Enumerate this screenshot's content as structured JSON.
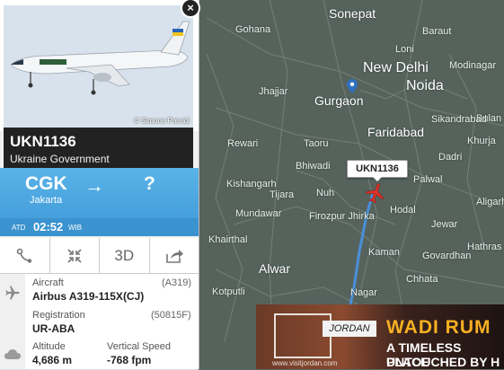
{
  "map": {
    "cities": [
      {
        "name": "Sonepat",
        "size": "m"
      },
      {
        "name": "New Delhi",
        "size": "l"
      },
      {
        "name": "Noida",
        "size": "l"
      },
      {
        "name": "Gurgaon",
        "size": "m"
      },
      {
        "name": "Faridabad",
        "size": "m"
      },
      {
        "name": "Jhajjar",
        "size": "s"
      },
      {
        "name": "Rewari",
        "size": "s"
      },
      {
        "name": "Bhiwadi",
        "size": "s"
      },
      {
        "name": "Palwal",
        "size": "s"
      },
      {
        "name": "Hodal",
        "size": "s"
      },
      {
        "name": "Mundawar",
        "size": "s"
      },
      {
        "name": "Firozpur Jhirka",
        "size": "s"
      },
      {
        "name": "Kaman",
        "size": "s"
      },
      {
        "name": "Alwar",
        "size": "m"
      },
      {
        "name": "Nagar",
        "size": "s"
      },
      {
        "name": "Bulan",
        "size": "s"
      },
      {
        "name": "Khurja",
        "size": "s"
      },
      {
        "name": "Aligarh",
        "size": "s"
      },
      {
        "name": "Chhata",
        "size": "s"
      },
      {
        "name": "Hathras",
        "size": "s"
      },
      {
        "name": "Jewar",
        "size": "s"
      },
      {
        "name": "Khairthal",
        "size": "s"
      },
      {
        "name": "Taoru",
        "size": "s"
      },
      {
        "name": "Nuh",
        "size": "s"
      },
      {
        "name": "Dadri",
        "size": "s"
      },
      {
        "name": "Tijara",
        "size": "s"
      },
      {
        "name": "Govardhan",
        "size": "s"
      },
      {
        "name": "Gohana",
        "size": "s"
      },
      {
        "name": "Baraut",
        "size": "s"
      },
      {
        "name": "Loni",
        "size": "s"
      },
      {
        "name": "Modinagar",
        "size": "s"
      },
      {
        "name": "Sikandrabad",
        "size": "s"
      },
      {
        "name": "Kishangarh",
        "size": "s"
      },
      {
        "name": "Kotputli",
        "size": "s"
      }
    ],
    "flight_label": "UKN1136"
  },
  "panel": {
    "photo_credit": "© Simone Previdi",
    "close_label": "×",
    "callsign": "UKN1136",
    "operator": "Ukraine Government",
    "route": {
      "from_code": "CGK",
      "from_city": "Jakarta",
      "arrow": "→",
      "to_code": "?"
    },
    "atd": {
      "label": "ATD",
      "time": "02:52",
      "tz": "WIB"
    },
    "tools": {
      "route_icon": "route-icon",
      "expand_icon": "expand-icon",
      "three_d_label": "3D",
      "share_icon": "share-icon"
    },
    "aircraft": {
      "label": "Aircraft",
      "code": "(A319)",
      "value": "Airbus A319-115X(CJ)"
    },
    "registration": {
      "label": "Registration",
      "code": "(50815F)",
      "value": "UR-ABA"
    },
    "altitude": {
      "label": "Altitude",
      "value": "4,686 m"
    },
    "vertical_speed": {
      "label": "Vertical Speed",
      "value": "-768 fpm"
    }
  },
  "ad": {
    "brand": "JORDAN",
    "site": "www.visitjordan.com",
    "headline": "WADI RUM",
    "line1": "A TIMELESS PLACE",
    "line2": "UNTOUCHED BY H"
  },
  "colors": {
    "map_bg": "#56635d",
    "route_blue": "#3e98d6",
    "plane_red": "#d9342b",
    "ad_accent": "#f7b021"
  }
}
